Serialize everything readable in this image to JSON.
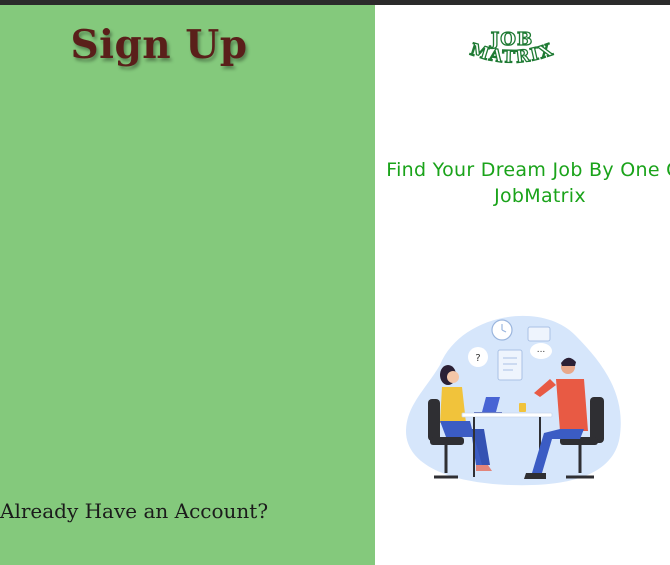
{
  "left_panel": {
    "title": "Sign Up",
    "already_account_link": "Already Have an Account?"
  },
  "right_panel": {
    "logo": {
      "line1": "JOB",
      "line2": "MATRIX"
    },
    "tagline": "Find Your Dream Job By One On JobMatrix",
    "illustration": {
      "bubble_question": "?",
      "bubble_dots": "..."
    }
  },
  "colors": {
    "left_bg": "#84c97c",
    "title_color": "#5a1f1a",
    "tagline_color": "#1aa31a",
    "logo_green": "#1e7a33"
  }
}
